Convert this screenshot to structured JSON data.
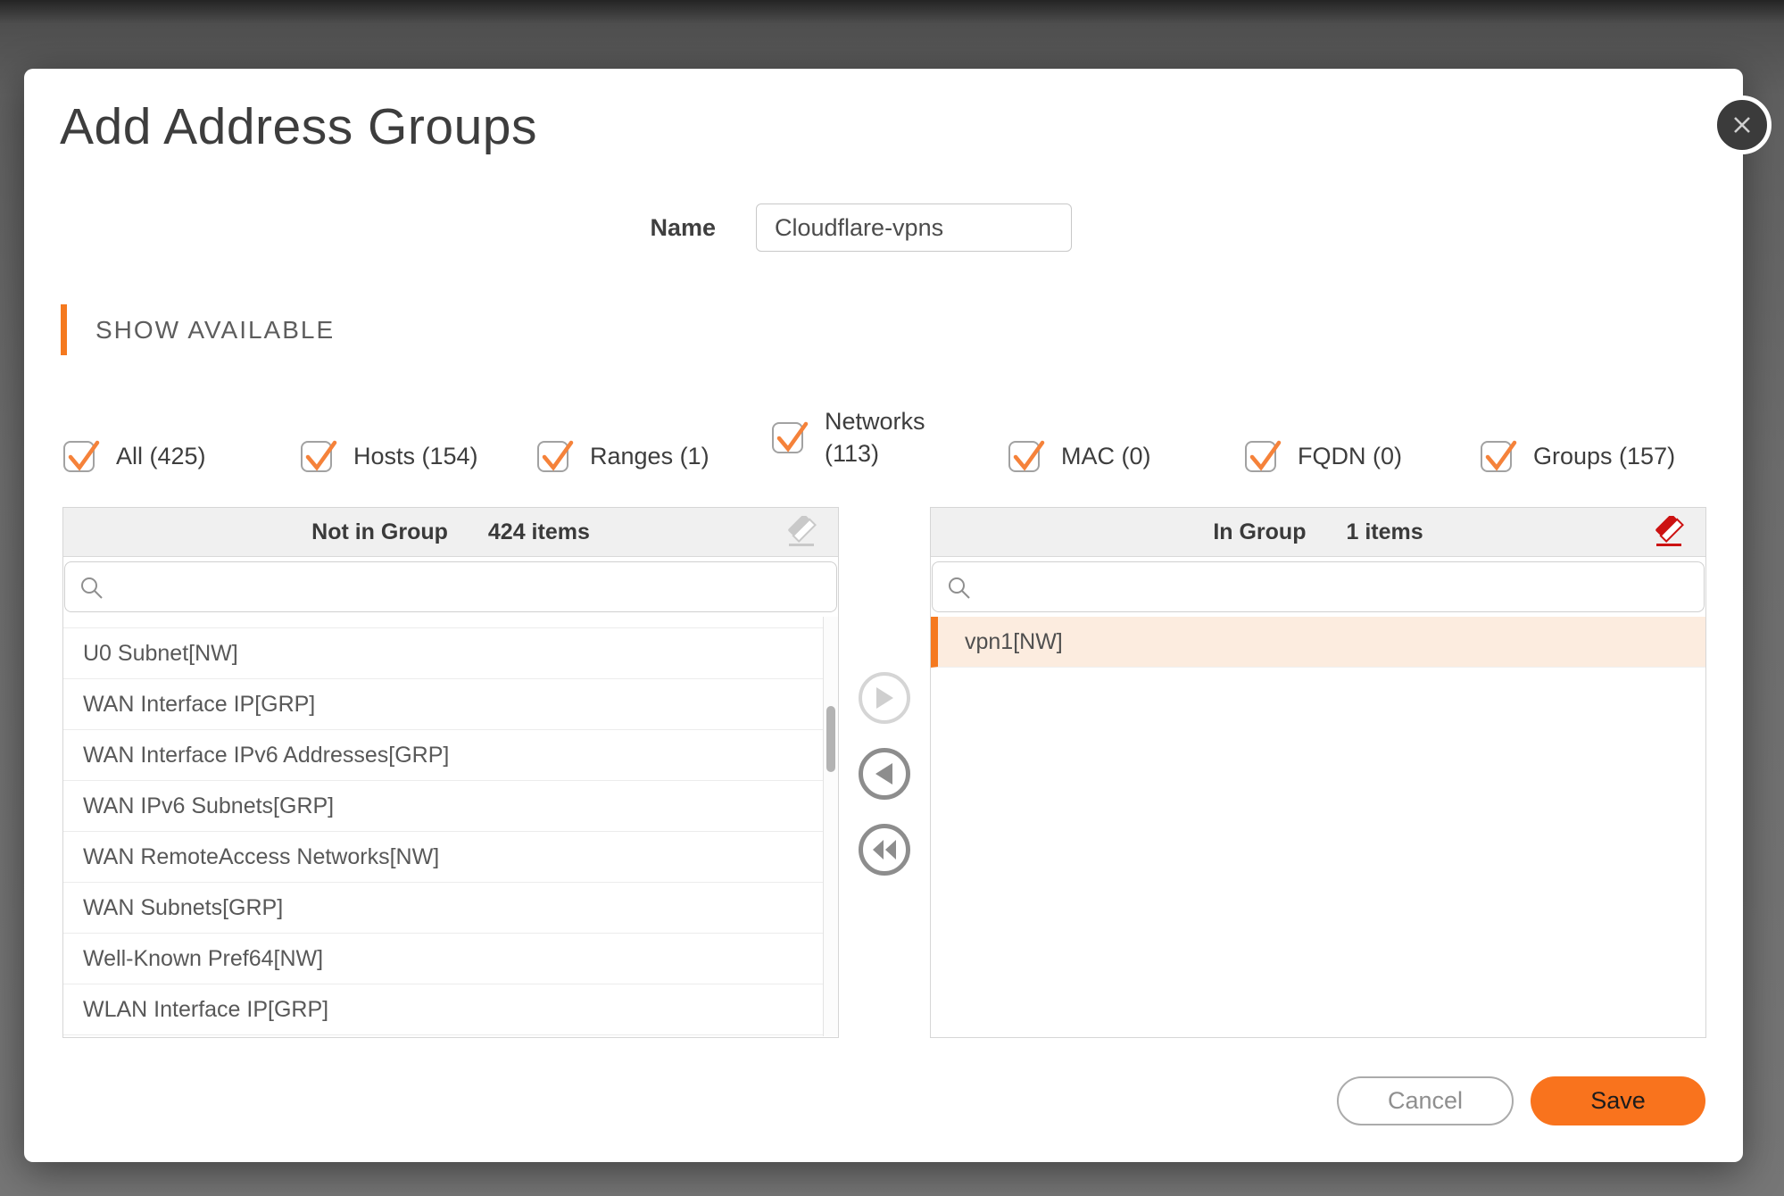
{
  "dialog": {
    "title": "Add Address Groups",
    "name_label": "Name",
    "name_value": "Cloudflare-vpns",
    "section_header": "SHOW AVAILABLE"
  },
  "filters": [
    {
      "label": "All (425)",
      "checked": true
    },
    {
      "label": "Hosts (154)",
      "checked": true
    },
    {
      "label": "Ranges (1)",
      "checked": true
    },
    {
      "label": "Networks (113)",
      "checked": true
    },
    {
      "label": "MAC (0)",
      "checked": true
    },
    {
      "label": "FQDN (0)",
      "checked": true
    },
    {
      "label": "Groups (157)",
      "checked": true
    }
  ],
  "left_panel": {
    "title": "Not in Group",
    "count": "424 items",
    "search_value": "",
    "items": [
      "U0 Subnet[NW]",
      "WAN Interface IP[GRP]",
      "WAN Interface IPv6 Addresses[GRP]",
      "WAN IPv6 Subnets[GRP]",
      "WAN RemoteAccess Networks[NW]",
      "WAN Subnets[GRP]",
      "Well-Known Pref64[NW]",
      "WLAN Interface IP[GRP]"
    ]
  },
  "right_panel": {
    "title": "In Group",
    "count": "1 items",
    "search_value": "",
    "items": [
      "vpn1[NW]"
    ]
  },
  "actions": {
    "cancel_label": "Cancel",
    "save_label": "Save"
  },
  "colors": {
    "accent_orange": "#f5791f",
    "save_button": "#f9731d",
    "eraser_red": "#cc1212",
    "selected_row_bg": "#fcecdf",
    "backdrop_gray": "#6d6d6d"
  }
}
